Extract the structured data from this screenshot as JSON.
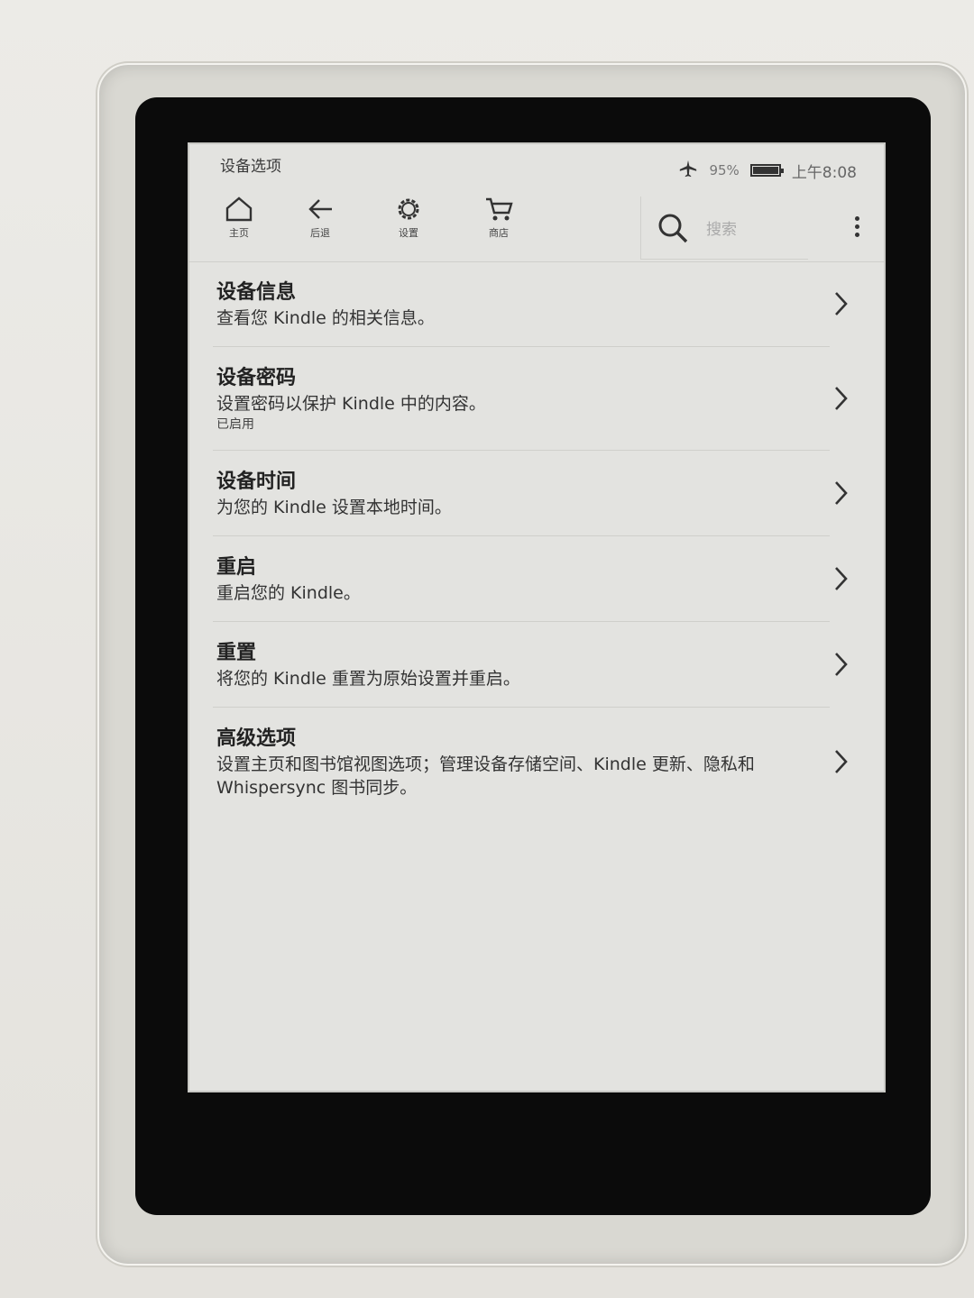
{
  "status": {
    "title": "设备选项",
    "battery": "95%",
    "time": "上午8:08"
  },
  "toolbar": {
    "home_label": "主页",
    "back_label": "后退",
    "settings_label": "设置",
    "store_label": "商店",
    "search_placeholder": "搜索"
  },
  "items": [
    {
      "title": "设备信息",
      "desc": "查看您 Kindle 的相关信息。",
      "sub": ""
    },
    {
      "title": "设备密码",
      "desc": "设置密码以保护 Kindle 中的内容。",
      "sub": "已启用"
    },
    {
      "title": "设备时间",
      "desc": "为您的 Kindle 设置本地时间。",
      "sub": ""
    },
    {
      "title": "重启",
      "desc": "重启您的 Kindle。",
      "sub": ""
    },
    {
      "title": "重置",
      "desc": "将您的 Kindle 重置为原始设置并重启。",
      "sub": ""
    },
    {
      "title": "高级选项",
      "desc": "设置主页和图书馆视图选项；管理设备存储空间、Kindle 更新、隐私和 Whispersync 图书同步。",
      "sub": ""
    }
  ]
}
